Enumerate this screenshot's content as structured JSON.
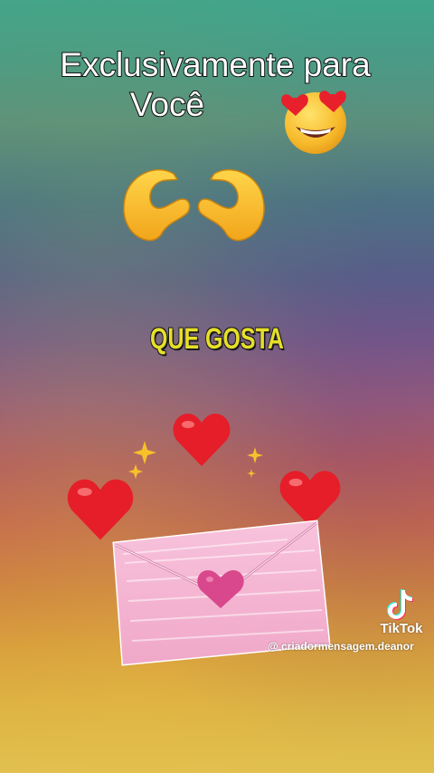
{
  "title": {
    "line1": "Exclusivamente para",
    "line2": "Você"
  },
  "caption": "QUE GOSTA",
  "watermark": {
    "brand": "TikTok",
    "handle": "@ criadormensagem.deanor"
  },
  "icons": {
    "heart_eyes": "heart-eyes-emoji",
    "heart_hands": "heart-hands-emoji",
    "hearts": "red-heart-emoji",
    "sparkles": "sparkles",
    "envelope": "love-letter-envelope",
    "tiktok_logo": "tiktok-logo"
  },
  "colors": {
    "caption": "#e5df2a",
    "heart": "#e0202a",
    "envelope": "#f3b6d0",
    "seal": "#d9488c"
  }
}
